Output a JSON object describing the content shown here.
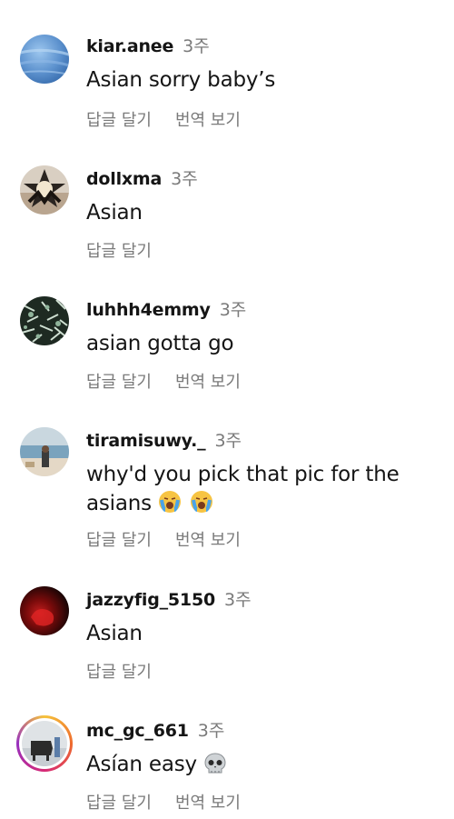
{
  "comments": [
    {
      "username": "kiar.anee",
      "time": "3주",
      "text": "Asian sorry baby’s",
      "reply_label": "답글 달기",
      "translate_label": "번역 보기",
      "avatar_icon": "blue-sphere-avatar"
    },
    {
      "username": "dollxma",
      "time": "3주",
      "text": "Asian",
      "reply_label": "답글 달기",
      "avatar_icon": "star-face-avatar"
    },
    {
      "username": "luhhh4emmy",
      "time": "3주",
      "text": "asian gotta go",
      "reply_label": "답글 달기",
      "translate_label": "번역 보기",
      "avatar_icon": "leaves-avatar"
    },
    {
      "username": "tiramisuwy._",
      "time": "3주",
      "text": "why'd you pick that pic for the asians",
      "reply_label": "답글 달기",
      "translate_label": "번역 보기",
      "avatar_icon": "beach-avatar",
      "emoji": "crying-face-emoji"
    },
    {
      "username": "jazzyfig_5150",
      "time": "3주",
      "text": "Asian",
      "reply_label": "답글 달기",
      "avatar_icon": "red-dark-avatar"
    },
    {
      "username": "mc_gc_661",
      "time": "3주",
      "text": "Asían easy",
      "reply_label": "답글 달기",
      "translate_label": "번역 보기",
      "avatar_icon": "story-ring-avatar",
      "emoji": "skull-emoji"
    }
  ],
  "colors": {
    "primary_text": "#151515",
    "secondary_text": "#7a7a7a",
    "background": "#ffffff"
  }
}
